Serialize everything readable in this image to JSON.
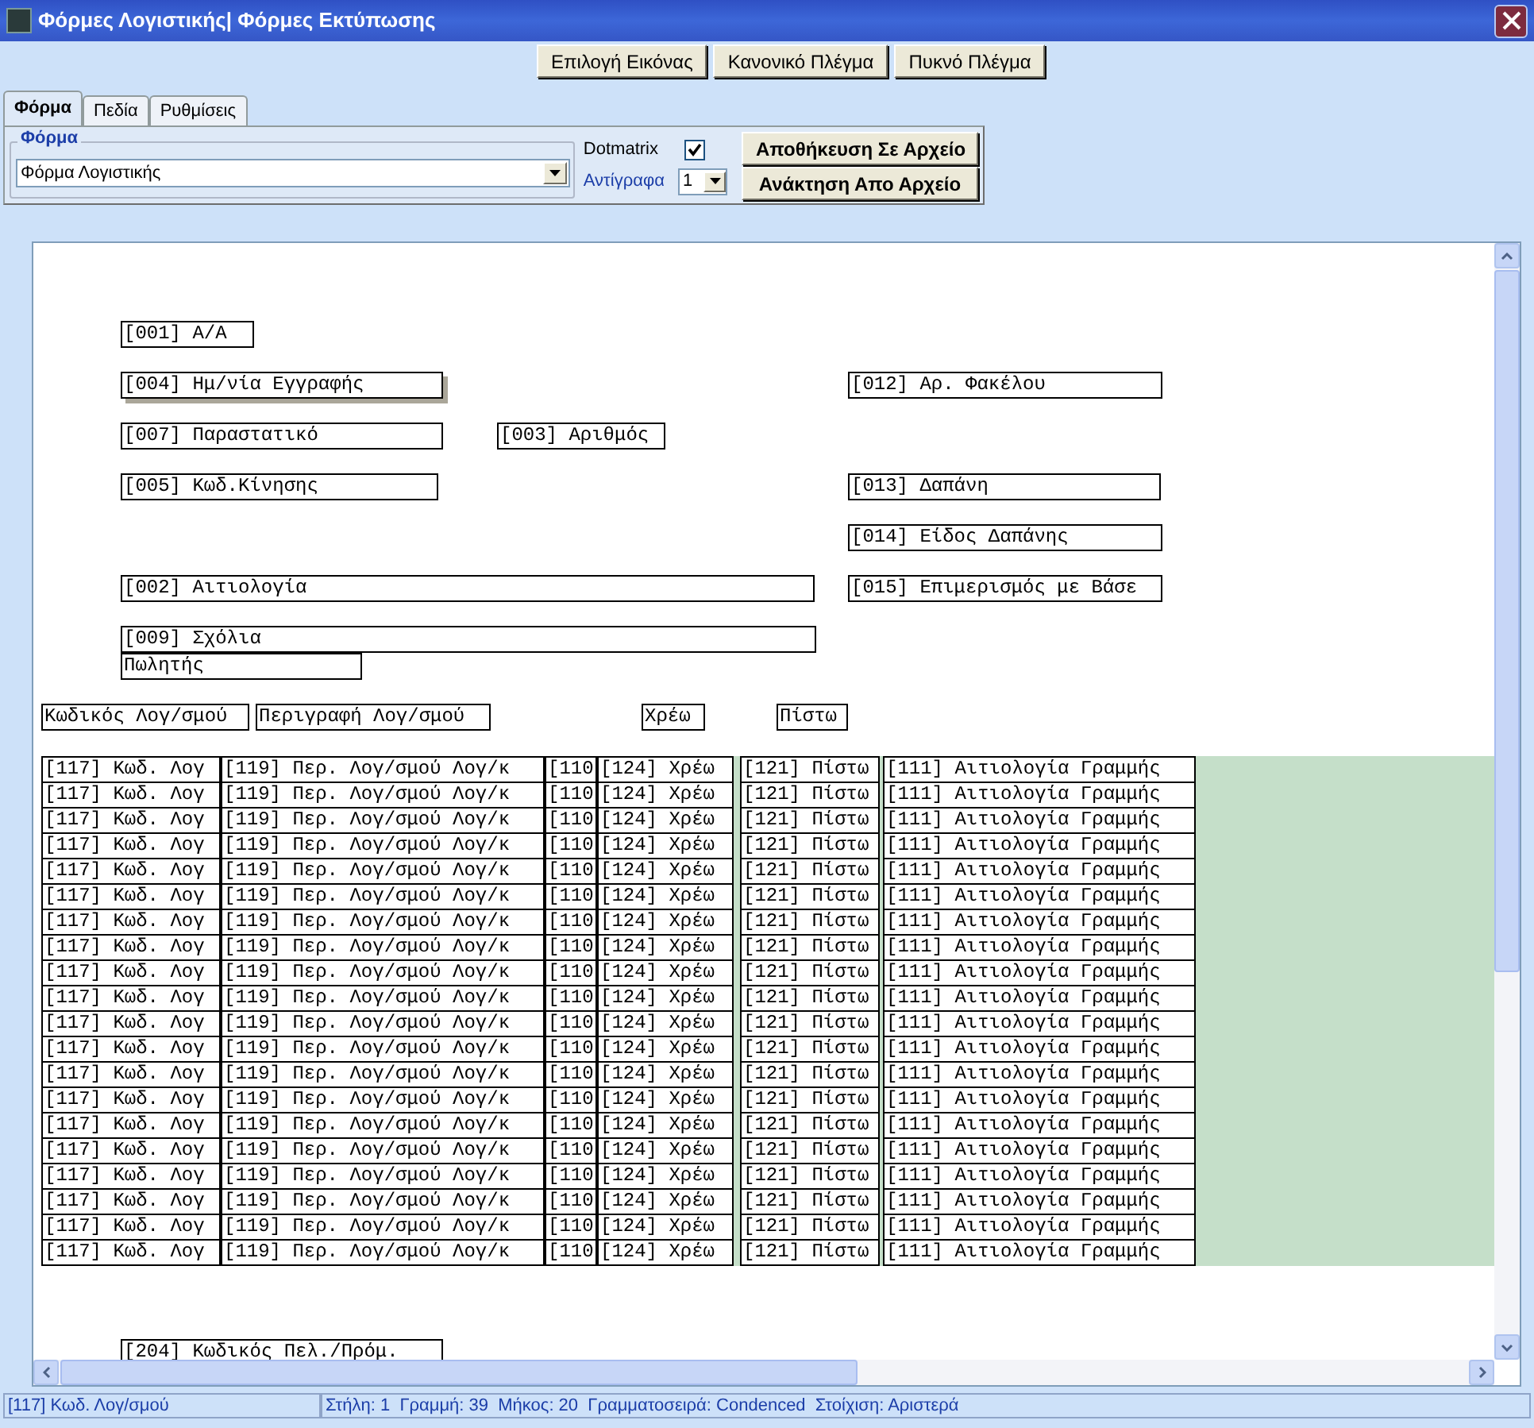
{
  "window": {
    "title": "Φόρμες Λογιστικής| Φόρμες Εκτύπωσης"
  },
  "toolbar": {
    "buttons": [
      "Επιλογή Εικόνας",
      "Κανονικό Πλέγμα",
      "Πυκνό Πλέγμα"
    ]
  },
  "tabs": [
    {
      "label": "Φόρμα",
      "selected": true
    },
    {
      "label": "Πεδία",
      "selected": false
    },
    {
      "label": "Ρυθμίσεις",
      "selected": false
    }
  ],
  "form_group": {
    "legend": "Φόρμα",
    "combo_value": "Φόρμα Λογιστικής"
  },
  "dotmatrix": {
    "label": "Dotmatrix",
    "checked": true
  },
  "copies": {
    "label": "Αντίγραφα",
    "value": "1"
  },
  "actions": [
    "Αποθήκευση Σε Αρχείο",
    "Ανάκτηση Απο Αρχείο"
  ],
  "canvas": {
    "fields": [
      {
        "label": "[001] Α/Α",
        "selected": false
      },
      {
        "label": "[004] Ημ/νία Εγγραφής",
        "selected": true
      },
      {
        "label": "[012] Αρ. Φακέλου",
        "selected": false
      },
      {
        "label": "[007] Παραστατικό",
        "selected": false
      },
      {
        "label": "[003] Αριθμός",
        "selected": false
      },
      {
        "label": "[005] Κωδ.Κίνησης",
        "selected": false
      },
      {
        "label": "[013] Δαπάνη",
        "selected": false
      },
      {
        "label": "[014] Είδος Δαπάνης",
        "selected": false
      },
      {
        "label": "[002] Αιτιολογία",
        "selected": false
      },
      {
        "label": "[015] Επιμερισμός με Βάσε",
        "selected": false
      },
      {
        "label": "[009] Σχόλια",
        "selected": false
      },
      {
        "label": "Πωλητής",
        "selected": false
      },
      {
        "label": "Κωδικός Λογ/σμού",
        "selected": false
      },
      {
        "label": "Περιγραφή Λογ/σμού",
        "selected": false
      },
      {
        "label": "Χρέω",
        "selected": false
      },
      {
        "label": "Πίστω",
        "selected": false
      },
      {
        "label": "[204] Κωδικός Πελ./Πρόμ.",
        "selected": false
      }
    ],
    "detail_rows": [
      [
        "[117] Κωδ. Λογ",
        "[119] Περ. Λογ/σμού Λογ/κ",
        "[110",
        "[124] Χρέω",
        "[121] Πίστω",
        "[111] Αιτιολογία Γραμμής"
      ],
      [
        "[117] Κωδ. Λογ",
        "[119] Περ. Λογ/σμού Λογ/κ",
        "[110",
        "[124] Χρέω",
        "[121] Πίστω",
        "[111] Αιτιολογία Γραμμής"
      ],
      [
        "[117] Κωδ. Λογ",
        "[119] Περ. Λογ/σμού Λογ/κ",
        "[110",
        "[124] Χρέω",
        "[121] Πίστω",
        "[111] Αιτιολογία Γραμμής"
      ],
      [
        "[117] Κωδ. Λογ",
        "[119] Περ. Λογ/σμού Λογ/κ",
        "[110",
        "[124] Χρέω",
        "[121] Πίστω",
        "[111] Αιτιολογία Γραμμής"
      ],
      [
        "[117] Κωδ. Λογ",
        "[119] Περ. Λογ/σμού Λογ/κ",
        "[110",
        "[124] Χρέω",
        "[121] Πίστω",
        "[111] Αιτιολογία Γραμμής"
      ],
      [
        "[117] Κωδ. Λογ",
        "[119] Περ. Λογ/σμού Λογ/κ",
        "[110",
        "[124] Χρέω",
        "[121] Πίστω",
        "[111] Αιτιολογία Γραμμής"
      ],
      [
        "[117] Κωδ. Λογ",
        "[119] Περ. Λογ/σμού Λογ/κ",
        "[110",
        "[124] Χρέω",
        "[121] Πίστω",
        "[111] Αιτιολογία Γραμμής"
      ],
      [
        "[117] Κωδ. Λογ",
        "[119] Περ. Λογ/σμού Λογ/κ",
        "[110",
        "[124] Χρέω",
        "[121] Πίστω",
        "[111] Αιτιολογία Γραμμής"
      ],
      [
        "[117] Κωδ. Λογ",
        "[119] Περ. Λογ/σμού Λογ/κ",
        "[110",
        "[124] Χρέω",
        "[121] Πίστω",
        "[111] Αιτιολογία Γραμμής"
      ],
      [
        "[117] Κωδ. Λογ",
        "[119] Περ. Λογ/σμού Λογ/κ",
        "[110",
        "[124] Χρέω",
        "[121] Πίστω",
        "[111] Αιτιολογία Γραμμής"
      ],
      [
        "[117] Κωδ. Λογ",
        "[119] Περ. Λογ/σμού Λογ/κ",
        "[110",
        "[124] Χρέω",
        "[121] Πίστω",
        "[111] Αιτιολογία Γραμμής"
      ],
      [
        "[117] Κωδ. Λογ",
        "[119] Περ. Λογ/σμού Λογ/κ",
        "[110",
        "[124] Χρέω",
        "[121] Πίστω",
        "[111] Αιτιολογία Γραμμής"
      ],
      [
        "[117] Κωδ. Λογ",
        "[119] Περ. Λογ/σμού Λογ/κ",
        "[110",
        "[124] Χρέω",
        "[121] Πίστω",
        "[111] Αιτιολογία Γραμμής"
      ],
      [
        "[117] Κωδ. Λογ",
        "[119] Περ. Λογ/σμού Λογ/κ",
        "[110",
        "[124] Χρέω",
        "[121] Πίστω",
        "[111] Αιτιολογία Γραμμής"
      ],
      [
        "[117] Κωδ. Λογ",
        "[119] Περ. Λογ/σμού Λογ/κ",
        "[110",
        "[124] Χρέω",
        "[121] Πίστω",
        "[111] Αιτιολογία Γραμμής"
      ],
      [
        "[117] Κωδ. Λογ",
        "[119] Περ. Λογ/σμού Λογ/κ",
        "[110",
        "[124] Χρέω",
        "[121] Πίστω",
        "[111] Αιτιολογία Γραμμής"
      ],
      [
        "[117] Κωδ. Λογ",
        "[119] Περ. Λογ/σμού Λογ/κ",
        "[110",
        "[124] Χρέω",
        "[121] Πίστω",
        "[111] Αιτιολογία Γραμμής"
      ],
      [
        "[117] Κωδ. Λογ",
        "[119] Περ. Λογ/σμού Λογ/κ",
        "[110",
        "[124] Χρέω",
        "[121] Πίστω",
        "[111] Αιτιολογία Γραμμής"
      ],
      [
        "[117] Κωδ. Λογ",
        "[119] Περ. Λογ/σμού Λογ/κ",
        "[110",
        "[124] Χρέω",
        "[121] Πίστω",
        "[111] Αιτιολογία Γραμμής"
      ],
      [
        "[117] Κωδ. Λογ",
        "[119] Περ. Λογ/σμού Λογ/κ",
        "[110",
        "[124] Χρέω",
        "[121] Πίστω",
        "[111] Αιτιολογία Γραμμής"
      ]
    ]
  },
  "status_bar": {
    "field": "[117] Κωδ. Λογ/σμού",
    "info": "Στήλη: 1  Γραμμή: 39  Μήκος: 20  Γραμματοσειρά: Condenced  Στοίχιση: Αριστερά"
  }
}
